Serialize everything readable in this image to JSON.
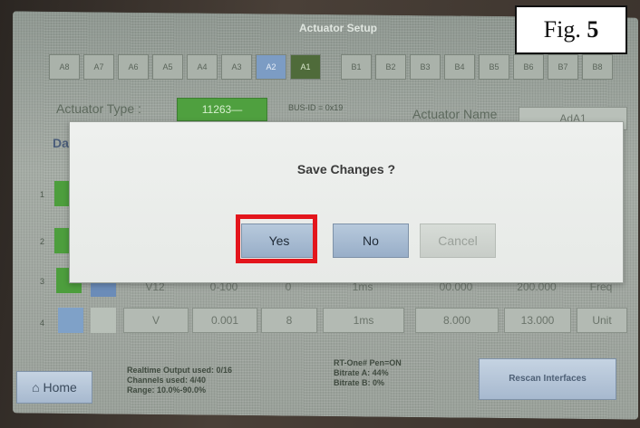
{
  "window": {
    "title": "Actuator Setup"
  },
  "figure_label": {
    "prefix": "Fig.",
    "number": "5"
  },
  "slots": {
    "left": [
      "A8",
      "A7",
      "A6",
      "A5",
      "A4",
      "A3",
      "A2",
      "A1"
    ],
    "right": [
      "B1",
      "B2",
      "B3",
      "B4",
      "B5",
      "B6",
      "B7",
      "B8"
    ],
    "active_blue": "A2",
    "active_green": "A1"
  },
  "header": {
    "actuator_type_label": "Actuator Type :",
    "actuator_type_value": "11263—",
    "bus_id": "BUS-ID = 0x19",
    "actuator_name_label": "Actuator Name",
    "actuator_name_value": "AdA1",
    "data_label": "Da"
  },
  "rows": {
    "row_numbers": [
      "1",
      "2",
      "3",
      "4"
    ],
    "row3_values": [
      "V12",
      "0-100",
      "0",
      "1ms",
      "00.000",
      "200.000",
      "Freq"
    ],
    "row4_values": [
      "V",
      "0.001",
      "8",
      "1ms",
      "8.000",
      "13.000",
      "Unit"
    ]
  },
  "dialog": {
    "title": "Save Changes ?",
    "yes": "Yes",
    "no": "No",
    "cancel": "Cancel"
  },
  "footer": {
    "home": "Home",
    "status": [
      "Realtime Output used: 0/16",
      "Channels used: 4/40",
      "Range: 10.0%-90.0%"
    ],
    "rt": [
      "RT-One#   Pen=ON",
      "Bitrate A:   44%",
      "Bitrate B:    0%"
    ],
    "rescan": "Rescan Interfaces"
  },
  "colors": {
    "highlight": "#e3151c",
    "dialog_bg": "#eef0ee",
    "button": "#a7bcd2"
  }
}
